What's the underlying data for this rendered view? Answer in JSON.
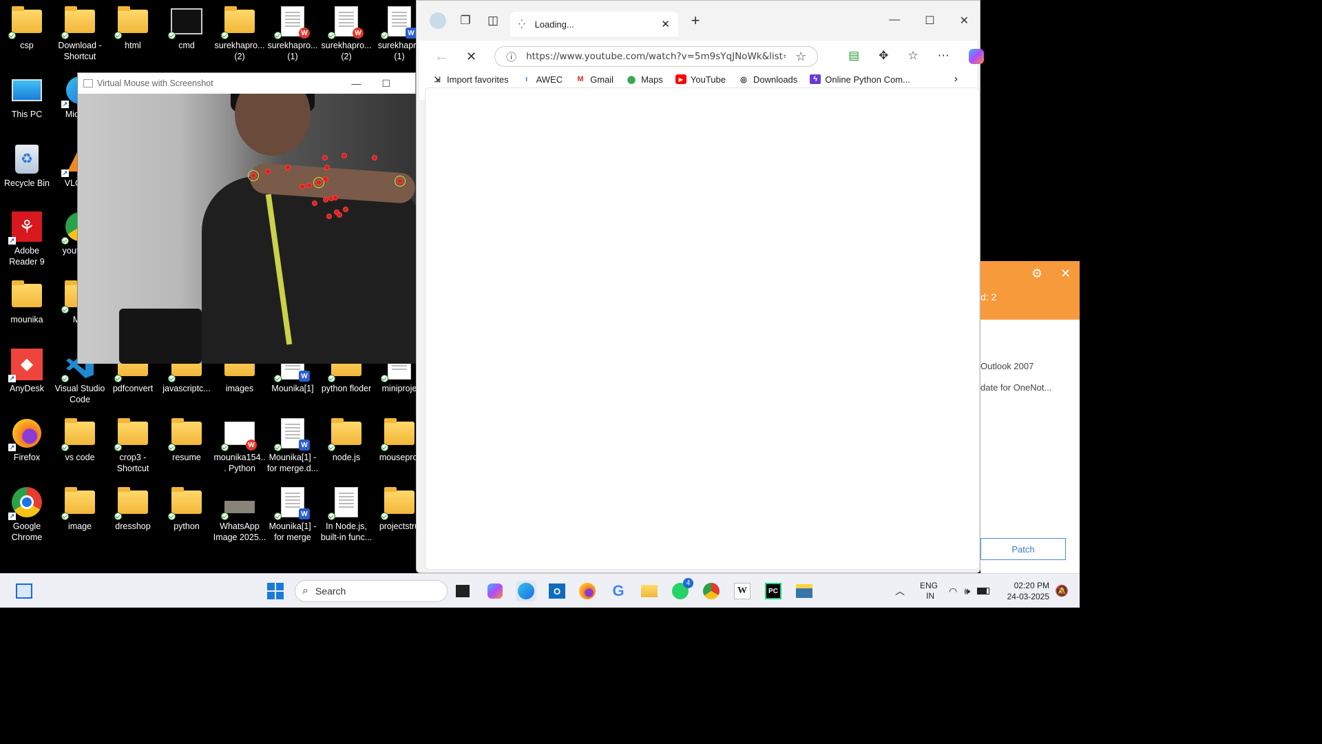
{
  "desktop": {
    "icons": [
      {
        "label": "csp"
      },
      {
        "label": "Download - Shortcut"
      },
      {
        "label": "html"
      },
      {
        "label": "cmd"
      },
      {
        "label": "surekhapro... (2)"
      },
      {
        "label": "surekhapro... (1)"
      },
      {
        "label": "surekhapro... (2)"
      },
      {
        "label": "surekhapro (1)"
      },
      {
        "label": "This PC"
      },
      {
        "label": "Micr Ed"
      },
      {
        "label": "Recycle Bin"
      },
      {
        "label": "VLC pla"
      },
      {
        "label": "Adobe Reader 9"
      },
      {
        "label": "yout Goo"
      },
      {
        "label": "mounika"
      },
      {
        "label": "MO"
      },
      {
        "label": "AnyDesk"
      },
      {
        "label": "Visual Studio Code"
      },
      {
        "label": "pdfconvert"
      },
      {
        "label": "javascriptc..."
      },
      {
        "label": "images"
      },
      {
        "label": "Mounika[1]"
      },
      {
        "label": "python floder"
      },
      {
        "label": "miniproje"
      },
      {
        "label": "Firefox"
      },
      {
        "label": "vs code"
      },
      {
        "label": "crop3 - Shortcut"
      },
      {
        "label": "resume"
      },
      {
        "label": "mounika154... Python"
      },
      {
        "label": "Mounika[1] - for merge.d..."
      },
      {
        "label": "node.js"
      },
      {
        "label": "mouseproj"
      },
      {
        "label": "Google Chrome"
      },
      {
        "label": "image"
      },
      {
        "label": "dresshop"
      },
      {
        "label": "python"
      },
      {
        "label": "WhatsApp Image 2025..."
      },
      {
        "label": "Mounika[1] - for merge"
      },
      {
        "label": "In Node.js, built-in func..."
      },
      {
        "label": "projectstru"
      }
    ]
  },
  "vm_window": {
    "title": "Virtual Mouse with Screenshot",
    "minimize": "—",
    "maximize": "☐"
  },
  "browser": {
    "tab_title": "Loading...",
    "url": "https://www.youtube.com/watch?v=5m9sYqJNoWk&list=...",
    "bookmarks": [
      "Import favorites",
      "AWEC",
      "Gmail",
      "Maps",
      "YouTube",
      "Downloads",
      "Online Python Com..."
    ]
  },
  "notification": {
    "count_text": "d: 2",
    "line1": "Outlook 2007",
    "line2": "date for OneNot...",
    "patch_label": "Patch"
  },
  "taskbar": {
    "search_placeholder": "Search",
    "lang_line1": "ENG",
    "lang_line2": "IN",
    "time": "02:20 PM",
    "date": "24-03-2025",
    "whatsapp_badge": "4"
  },
  "colors": {
    "notification_accent": "#f79a3c",
    "taskbar_bg": "#eef0f5"
  }
}
